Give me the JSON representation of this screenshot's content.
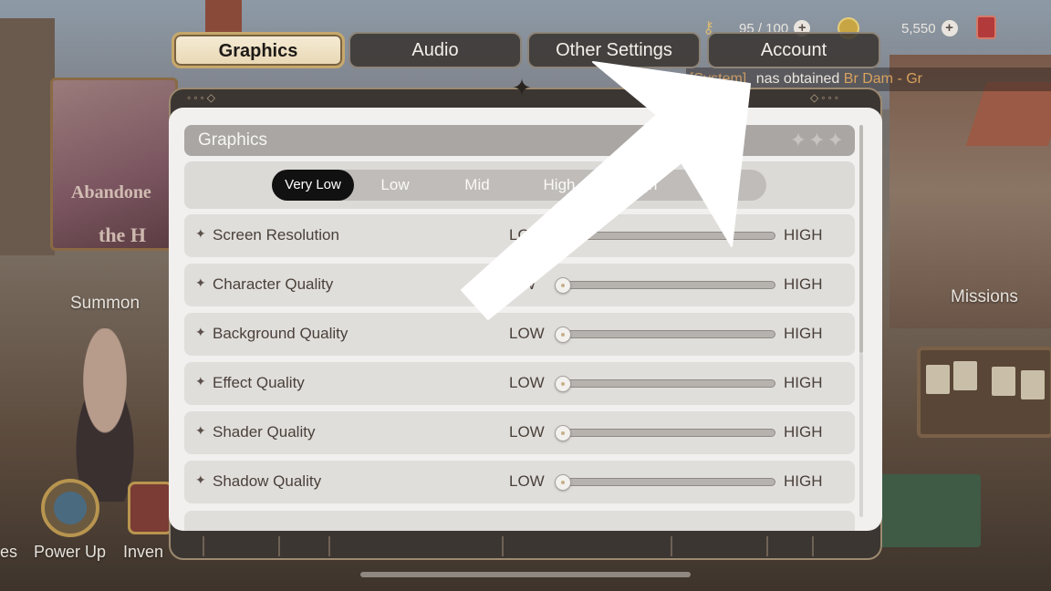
{
  "background": {
    "poster_text_line1": "Abandone",
    "poster_text_line2": "the H",
    "labels": {
      "summon": "Summon",
      "missions": "Missions",
      "power_up": "Power Up",
      "inventory": "Inven",
      "left_cut": "es"
    }
  },
  "resources": {
    "stamina": "95 / 100",
    "gold": "5,550"
  },
  "chat": {
    "system_tag": "[System]",
    "message_prefix": "nas obtained",
    "item_name": "Br Dam - Gr"
  },
  "tabs": [
    {
      "label": "Graphics",
      "active": true
    },
    {
      "label": "Audio",
      "active": false
    },
    {
      "label": "Other Settings",
      "active": false
    },
    {
      "label": "Account",
      "active": false
    }
  ],
  "section": {
    "title": "Graphics"
  },
  "presets": [
    {
      "label": "Very Low",
      "active": true
    },
    {
      "label": "Low",
      "active": false
    },
    {
      "label": "Mid",
      "active": false
    },
    {
      "label": "High",
      "active": false
    },
    {
      "label": "High",
      "active": false
    },
    {
      "label": "tom",
      "active": false
    }
  ],
  "slider_labels": {
    "low": "LOW",
    "high": "HIGH"
  },
  "settings": [
    {
      "label": "Screen Resolution",
      "low": "LO",
      "value": 0.0
    },
    {
      "label": "Character Quality",
      "low": "OW",
      "value": 0.0
    },
    {
      "label": "Background Quality",
      "low": "LOW",
      "value": 0.0
    },
    {
      "label": "Effect Quality",
      "low": "LOW",
      "value": 0.0
    },
    {
      "label": "Shader Quality",
      "low": "LOW",
      "value": 0.0
    },
    {
      "label": "Shadow Quality",
      "low": "LOW",
      "value": 0.0
    }
  ],
  "colors": {
    "active_tab": "#f6ecd6",
    "active_preset": "#111111",
    "panel": "#f1f0ef",
    "overlay_arrow": "#ffffff"
  }
}
